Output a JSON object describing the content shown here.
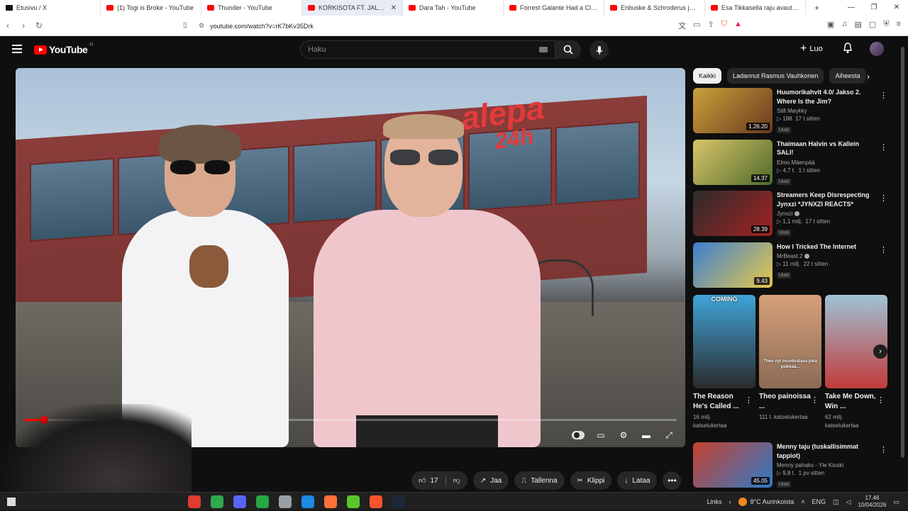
{
  "browser": {
    "tabs": [
      {
        "title": "Etusivu / X",
        "favicon": "x-icon",
        "active": false
      },
      {
        "title": "(1) Togi is Broke - YouTube",
        "favicon": "youtube-icon",
        "active": false
      },
      {
        "title": "Thunder - YouTube",
        "favicon": "youtube-icon",
        "active": false
      },
      {
        "title": "KORKISOTA FT. JALONE",
        "favicon": "youtube-icon",
        "active": true
      },
      {
        "title": "Dara Tah - YouTube",
        "favicon": "youtube-icon",
        "active": false
      },
      {
        "title": "Forrest Galante Had a Close Ca",
        "favicon": "youtube-icon",
        "active": false
      },
      {
        "title": "Enbuske & Schroderus jakso",
        "favicon": "youtube-icon",
        "active": false
      },
      {
        "title": "Esa Tikkasella raju avautumme",
        "favicon": "youtube-icon",
        "active": false
      }
    ],
    "new_tab": "+",
    "url": "youtube.com/watch?v=rK7bKv35Drk"
  },
  "youtube": {
    "logo_text": "YouTube",
    "logo_region": "FI",
    "search_placeholder": "Haku",
    "create_label": "Luo"
  },
  "video": {
    "sign_line1": "alepa",
    "sign_line2": "24h",
    "progress_fraction": 0.03
  },
  "actions": {
    "likes": "17",
    "share": "Jaa",
    "save": "Tallenna",
    "clip": "Klippi",
    "download": "Lataa"
  },
  "chips": [
    {
      "label": "Kaikki",
      "active": true
    },
    {
      "label": "Ladannut Rasmus Vauhkonen",
      "active": false
    },
    {
      "label": "Aiheesta",
      "active": false
    }
  ],
  "recommendations": [
    {
      "title": "Huumorikahvit 4.0/ Jakso 2. Where Is the Jim?",
      "channel": "Still Møykky",
      "verified": false,
      "views": "188",
      "age": "17 t sitten",
      "duration": "1.26.20",
      "badge": "Uusi",
      "thumb_colors": [
        "#c9a13b",
        "#6a3a1e"
      ]
    },
    {
      "title": "Thaimaan Halvin vs Kallein SALI!",
      "channel": "Elmo Mäenpää",
      "verified": false,
      "views": "4,7 t.",
      "age": "1 t sitten",
      "duration": "14.37",
      "badge": "Uusi",
      "thumb_colors": [
        "#d8c56a",
        "#4f6b2a"
      ]
    },
    {
      "title": "Streamers Keep Disrespecting Jynxzi *JYNXZI REACTS*",
      "channel": "Jynxzi",
      "verified": true,
      "views": "1,1 milj.",
      "age": "17 t sitten",
      "duration": "28.39",
      "badge": "Uusi",
      "thumb_colors": [
        "#2c2c2c",
        "#a42222"
      ]
    },
    {
      "title": "How I Tricked The Internet",
      "channel": "MrBeast 2",
      "verified": true,
      "views": "11 milj.",
      "age": "22 t sitten",
      "duration": "9.43",
      "badge": "Uusi",
      "thumb_colors": [
        "#3b7fd1",
        "#e7c84a"
      ]
    }
  ],
  "shorts": [
    {
      "title": "The Reason He's Called ...",
      "views": "16 milj. katselukertaa",
      "overlay": "COMING",
      "thumb_colors": [
        "#3fa4d9",
        "#2b2b2b"
      ]
    },
    {
      "title": "Theo painoissa ...",
      "views": "111 t. katselukertaa",
      "overlay": "Theo nyt muodostava joka pelkkää...",
      "thumb_colors": [
        "#d7a07a",
        "#8b6b55"
      ]
    },
    {
      "title": "Take Me Down, Win ...",
      "views": "62 milj. katselukertaa",
      "overlay": "",
      "thumb_colors": [
        "#9fc3d6",
        "#c23a3a"
      ]
    }
  ],
  "last_recommendation": {
    "title": "Menny taju (tuskallisimmat tappiot)",
    "channel": "Menny pahaks - Yle Kioski",
    "views": "9,8 t.",
    "age": "1 pv sitten",
    "duration": "45.05",
    "badge": "Uusi",
    "thumb_colors": [
      "#c8402f",
      "#2f7bc8"
    ]
  },
  "taskbar": {
    "links_label": "Links",
    "weather": "8°C  Aurinkoista",
    "language": "ENG",
    "time": "17.46",
    "date": "10/04/2026",
    "app_colors": [
      "#e03c2f",
      "#2fa84f",
      "#5865f2",
      "#28a745",
      "#9aa0a6",
      "#1e88e5",
      "#ff7139",
      "#5ac62b",
      "#fb542b",
      "#1b2838"
    ]
  },
  "colors": {
    "youtube_red": "#ff0000",
    "background": "#0f0f0f",
    "chip_bg": "#272727"
  }
}
